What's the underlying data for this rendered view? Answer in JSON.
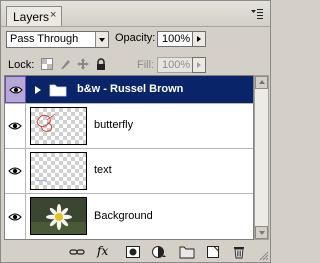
{
  "panel": {
    "tab_label": "Layers",
    "close_glyph": "×"
  },
  "blend": {
    "mode": "Pass Through",
    "opacity_label": "Opacity:",
    "opacity_value": "100%"
  },
  "lock": {
    "label": "Lock:",
    "fill_label": "Fill:",
    "fill_value": "100%"
  },
  "layers": [
    {
      "name": "b&w - Russel Brown",
      "type": "group",
      "selected": true,
      "visible": true
    },
    {
      "name": "butterfly",
      "type": "layer",
      "visible": true,
      "thumbnail": "transparent-with-red-sketch"
    },
    {
      "name": "text",
      "type": "layer",
      "visible": true,
      "thumbnail": "transparent"
    },
    {
      "name": "Background",
      "type": "layer",
      "visible": true,
      "thumbnail": "daisy-photo"
    }
  ],
  "toolbar": {
    "fx_label": "fx",
    "icons": [
      "link-layers-icon",
      "layer-style-icon",
      "add-mask-icon",
      "adjustment-layer-icon",
      "new-group-icon",
      "new-layer-icon",
      "delete-layer-icon"
    ]
  },
  "colors": {
    "selection": "#0a246a",
    "panel_bg": "#d4d0c8"
  }
}
